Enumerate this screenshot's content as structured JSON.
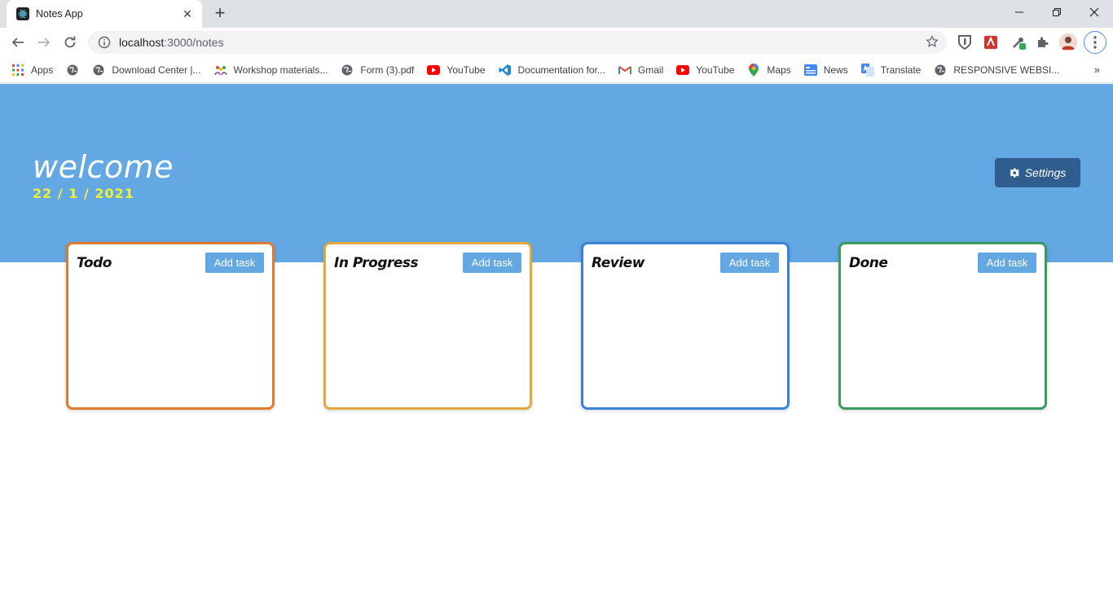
{
  "browser": {
    "tab_title": "Notes App",
    "url_host": "localhost",
    "url_rest": ":3000/notes",
    "bookmarks": [
      {
        "label": "Apps",
        "icon": "apps-grid-icon"
      },
      {
        "label": "",
        "icon": "globe-icon"
      },
      {
        "label": "Download Center |...",
        "icon": "globe-icon"
      },
      {
        "label": "Workshop materials...",
        "icon": "people-icon"
      },
      {
        "label": "Form (3).pdf",
        "icon": "globe-icon"
      },
      {
        "label": "YouTube",
        "icon": "youtube-icon"
      },
      {
        "label": "Documentation for...",
        "icon": "vscode-icon"
      },
      {
        "label": "Gmail",
        "icon": "gmail-icon"
      },
      {
        "label": "YouTube",
        "icon": "youtube-icon"
      },
      {
        "label": "Maps",
        "icon": "maps-icon"
      },
      {
        "label": "News",
        "icon": "news-icon"
      },
      {
        "label": "Translate",
        "icon": "translate-icon"
      },
      {
        "label": "RESPONSIVE WEBSI...",
        "icon": "globe-icon"
      }
    ],
    "bookmarks_more": "»"
  },
  "app": {
    "greeting": "welcome",
    "date": "22 / 1 / 2021",
    "settings_label": "Settings",
    "columns": [
      {
        "title": "Todo",
        "add_label": "Add task",
        "color": "#e07a2f"
      },
      {
        "title": "In Progress",
        "add_label": "Add task",
        "color": "#e2a83c"
      },
      {
        "title": "Review",
        "add_label": "Add task",
        "color": "#3b82d6"
      },
      {
        "title": "Done",
        "add_label": "Add task",
        "color": "#3a9b5e"
      }
    ]
  },
  "colors": {
    "hero": "#63a7e3",
    "settings_button": "#2f5d8e",
    "date_text": "#f2ef38"
  }
}
